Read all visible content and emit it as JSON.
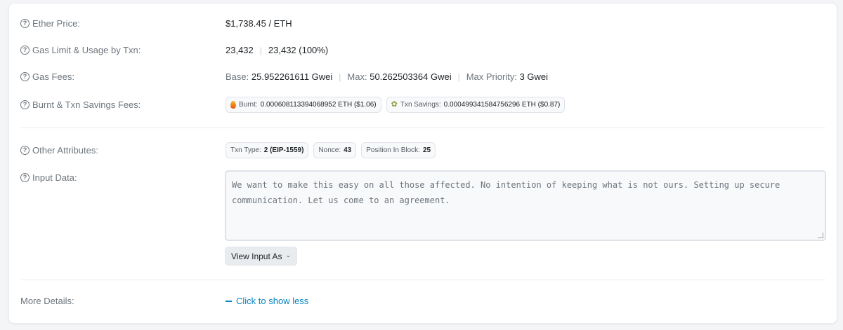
{
  "ether_price": {
    "label": "Ether Price:",
    "value": "$1,738.45 / ETH"
  },
  "gas_limit": {
    "label": "Gas Limit & Usage by Txn:",
    "limit": "23,432",
    "separator": "|",
    "usage": "23,432 (100%)"
  },
  "gas_fees": {
    "label": "Gas Fees:",
    "base_label": "Base:",
    "base_value": "25.952261611 Gwei",
    "max_label": "Max:",
    "max_value": "50.262503364 Gwei",
    "priority_label": "Max Priority:",
    "priority_value": "3 Gwei",
    "separator": "|"
  },
  "burnt_fees": {
    "label": "Burnt & Txn Savings Fees:",
    "burnt_label": "Burnt:",
    "burnt_value": "0.000608113394068952 ETH ($1.06)",
    "savings_label": "Txn Savings:",
    "savings_value": "0.000499341584756296 ETH ($0.87)"
  },
  "other_attributes": {
    "label": "Other Attributes:",
    "txn_type_label": "Txn Type:",
    "txn_type_value": "2 (EIP-1559)",
    "nonce_label": "Nonce:",
    "nonce_value": "43",
    "position_label": "Position In Block:",
    "position_value": "25"
  },
  "input_data": {
    "label": "Input Data:",
    "text": "We want to make this easy on all those affected. No intention of keeping what is not ours. Setting up secure communication. Let us come to an agreement.",
    "view_button_label": "View Input As"
  },
  "more_details": {
    "label": "More Details:",
    "toggle_label": "Click to show less"
  },
  "icons": {
    "help": "question-circle-icon",
    "burnt": "flame-icon",
    "savings": "leaf-icon",
    "chevron": "chevron-down-icon",
    "collapse": "minus-icon"
  },
  "colors": {
    "link": "#0784c3",
    "label": "#6c757d",
    "text": "#212529"
  }
}
